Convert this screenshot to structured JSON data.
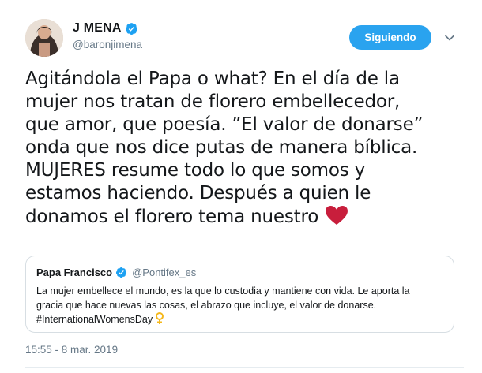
{
  "author": {
    "display_name": "J MENA",
    "handle": "@baronjimena",
    "verified": true
  },
  "follow_button": {
    "label": "Siguiendo"
  },
  "tweet": {
    "lines": [
      "Agitándola el Papa o what? En el día de la",
      "mujer nos tratan de florero embellecedor,",
      "que amor, que poesía. ”El valor de donarse”",
      "onda que nos dice putas de manera bíblica.",
      "MUJERES resume todo lo que somos y",
      "estamos haciendo. Después a quien le",
      "donamos el florero tema nuestro"
    ],
    "emoji": "heart-emoji"
  },
  "quoted_tweet": {
    "author_name": "Papa Francisco",
    "author_handle": "@Pontifex_es",
    "verified": true,
    "lines": [
      "La mujer embellece el mundo, es la que lo custodia y mantiene con vida. Le aporta la",
      "gracia que hace nuevas las cosas, el abrazo que incluye, el valor de donarse.",
      "#InternationalWomensDay"
    ],
    "emoji": "female-sign-emoji"
  },
  "timestamp": "15:55 - 8 mar. 2019",
  "colors": {
    "brand_blue": "#1da1f2",
    "heart_red": "#c81e3c",
    "muted_text": "#657786"
  },
  "icons": [
    "verified-badge-icon",
    "chevron-down-icon",
    "heart-emoji",
    "female-sign-emoji"
  ]
}
